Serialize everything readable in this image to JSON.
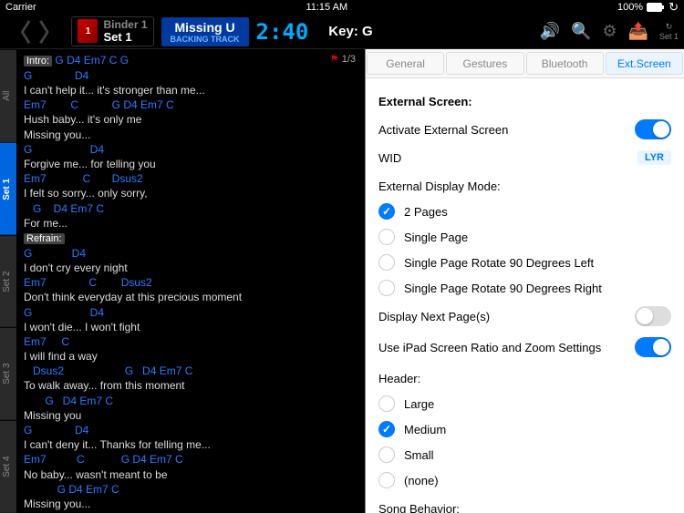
{
  "status": {
    "carrier": "Carrier",
    "time": "11:15 AM",
    "battery": "100%"
  },
  "top": {
    "binder_name": "Binder 1",
    "set_name": "Set 1",
    "binder_num": "1",
    "song_title": "Missing U",
    "song_sub": "BACKING TRACK",
    "time": "2:40",
    "key": "Key: G",
    "set_right": "Set 1",
    "set_num": "1"
  },
  "sidetabs": [
    "All",
    "Set 1",
    "Set 2",
    "Set 3",
    "Set 4"
  ],
  "page_indicator": "1/3",
  "lyrics": [
    {
      "t": "section",
      "v": "Intro:"
    },
    {
      "t": "chords-inline",
      "v": " G D4 Em7 C G"
    },
    {
      "t": "chords",
      "v": "G              D4"
    },
    {
      "t": "lyric",
      "v": "I can't help it... it's stronger than me..."
    },
    {
      "t": "chords",
      "v": "Em7        C           G D4 Em7 C"
    },
    {
      "t": "lyric",
      "v": "Hush baby... it's only me"
    },
    {
      "t": "lyric",
      "v": "Missing you..."
    },
    {
      "t": "chords",
      "v": "G                   D4"
    },
    {
      "t": "lyric",
      "v": "Forgive me... for telling you"
    },
    {
      "t": "chords",
      "v": "Em7            C       Dsus2"
    },
    {
      "t": "lyric",
      "v": "I felt so sorry... only sorry,"
    },
    {
      "t": "chords",
      "v": "   G    D4 Em7 C"
    },
    {
      "t": "lyric",
      "v": "For me..."
    },
    {
      "t": "section",
      "v": "Refrain:"
    },
    {
      "t": "chords",
      "v": "G             D4"
    },
    {
      "t": "lyric",
      "v": "I don't cry every night"
    },
    {
      "t": "chords",
      "v": "Em7              C        Dsus2"
    },
    {
      "t": "lyric",
      "v": "Don't think everyday at this precious moment"
    },
    {
      "t": "chords",
      "v": "G                   D4"
    },
    {
      "t": "lyric",
      "v": "I won't die... I won't fight"
    },
    {
      "t": "chords",
      "v": "Em7     C"
    },
    {
      "t": "lyric",
      "v": "I will find a way"
    },
    {
      "t": "chords",
      "v": "   Dsus2                    G   D4 Em7 C"
    },
    {
      "t": "lyric",
      "v": "To walk away... from this moment"
    },
    {
      "t": "chords",
      "v": "       G   D4 Em7 C"
    },
    {
      "t": "lyric",
      "v": "Missing you"
    },
    {
      "t": "chords",
      "v": "G              D4"
    },
    {
      "t": "lyric",
      "v": "I can't deny it... Thanks for telling me..."
    },
    {
      "t": "chords",
      "v": "Em7          C            G D4 Em7 C"
    },
    {
      "t": "lyric",
      "v": "No baby... wasn't meant to be"
    },
    {
      "t": "chords",
      "v": "           G D4 Em7 C"
    },
    {
      "t": "lyric",
      "v": "Missing you..."
    }
  ],
  "panel": {
    "tabs": [
      "General",
      "Gestures",
      "Bluetooth",
      "Ext.Screen"
    ],
    "h1": "External Screen:",
    "activate_label": "Activate External Screen",
    "wid_label": "WID",
    "wid_value": "LYR",
    "mode_label": "External Display Mode:",
    "modes": [
      "2 Pages",
      "Single Page",
      "Single Page Rotate 90 Degrees Left",
      "Single Page Rotate 90 Degrees Right"
    ],
    "next_label": "Display Next Page(s)",
    "ratio_label": "Use iPad Screen Ratio and Zoom Settings",
    "header_label": "Header:",
    "headers": [
      "Large",
      "Medium",
      "Small",
      "(none)"
    ],
    "behavior_label": "Song Behavior:"
  }
}
